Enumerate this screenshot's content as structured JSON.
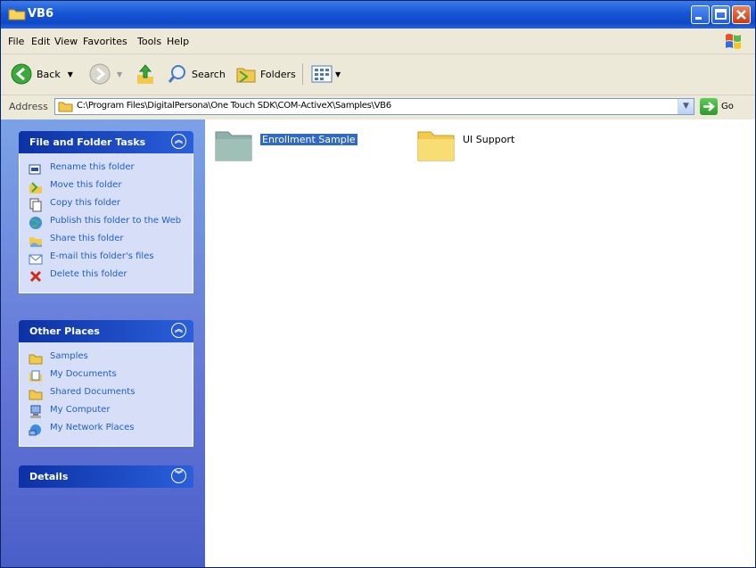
{
  "window": {
    "title": "VB6"
  },
  "menu": [
    "File",
    "Edit",
    "View",
    "Favorites",
    "Tools",
    "Help"
  ],
  "toolbar": {
    "back_label": "Back",
    "search_label": "Search",
    "folders_label": "Folders"
  },
  "address": {
    "label": "Address",
    "value": "C:\\Program Files\\DigitalPersona\\One Touch SDK\\COM-ActiveX\\Samples\\VB6",
    "go_label": "Go"
  },
  "tasks": {
    "title": "File and Folder Tasks",
    "items": [
      "Rename this folder",
      "Move this folder",
      "Copy this folder",
      "Publish this folder to the Web",
      "Share this folder",
      "E-mail this folder's files",
      "Delete this folder"
    ]
  },
  "other_places": {
    "title": "Other Places",
    "items": [
      "Samples",
      "My Documents",
      "Shared Documents",
      "My Computer",
      "My Network Places"
    ]
  },
  "details": {
    "title": "Details"
  },
  "folders": [
    {
      "name": "Enrollment Sample",
      "selected": true
    },
    {
      "name": "UI Support",
      "selected": false
    }
  ],
  "colors": {
    "title_bar": "#1555d6",
    "panel_link": "#215dc6",
    "selection": "#316ac5",
    "left_pane": "#6375d6"
  }
}
